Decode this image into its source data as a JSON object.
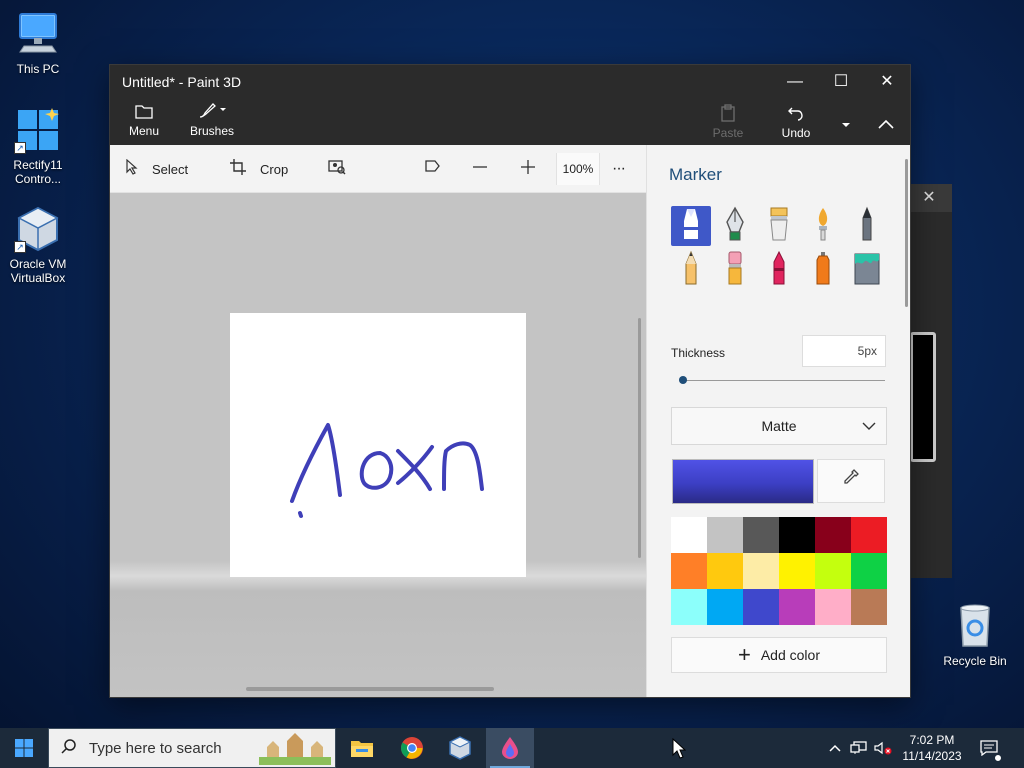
{
  "desktop": {
    "icons": [
      {
        "label": "This PC"
      },
      {
        "label": "Rectify11 Contro..."
      },
      {
        "label": "Oracle VM VirtualBox"
      },
      {
        "label": "Recycle Bin"
      }
    ]
  },
  "window": {
    "title": "Untitled* - Paint 3D",
    "controls": {
      "minimize": "—",
      "maximize": "☐",
      "close": "✕"
    }
  },
  "ribbon": {
    "menu_label": "Menu",
    "brushes_label": "Brushes",
    "paste_label": "Paste",
    "undo_label": "Undo"
  },
  "toolbar": {
    "select_label": "Select",
    "crop_label": "Crop",
    "zoom_level": "100%",
    "more": "···"
  },
  "canvas": {
    "ink_color": "#3f3fb8",
    "handwriting_description": "handwritten strokes"
  },
  "panel": {
    "title": "Marker",
    "brushes": [
      {
        "name": "marker",
        "selected": true
      },
      {
        "name": "calligraphy-pen",
        "selected": false
      },
      {
        "name": "oil-brush",
        "selected": false
      },
      {
        "name": "watercolor",
        "selected": false
      },
      {
        "name": "pixel-pen",
        "selected": false
      },
      {
        "name": "pencil",
        "selected": false
      },
      {
        "name": "eraser",
        "selected": false
      },
      {
        "name": "crayon",
        "selected": false
      },
      {
        "name": "spray-can",
        "selected": false
      },
      {
        "name": "fill",
        "selected": false
      }
    ],
    "thickness_label": "Thickness",
    "thickness_value": "5px",
    "finish_value": "Matte",
    "current_color": "#3c3fc4",
    "palette": [
      "#ffffff",
      "#c3c3c3",
      "#585858",
      "#000000",
      "#88001b",
      "#ec1c24",
      "#ff7f27",
      "#ffc90e",
      "#fdeca6",
      "#fff200",
      "#c4ff0e",
      "#0ed145",
      "#8cfffb",
      "#00a8f3",
      "#3f48cc",
      "#b83dba",
      "#ffaec8",
      "#b97a56"
    ],
    "add_color_label": "Add color"
  },
  "taskbar": {
    "search_placeholder": "Type here to search",
    "time": "7:02 PM",
    "date": "11/14/2023"
  }
}
